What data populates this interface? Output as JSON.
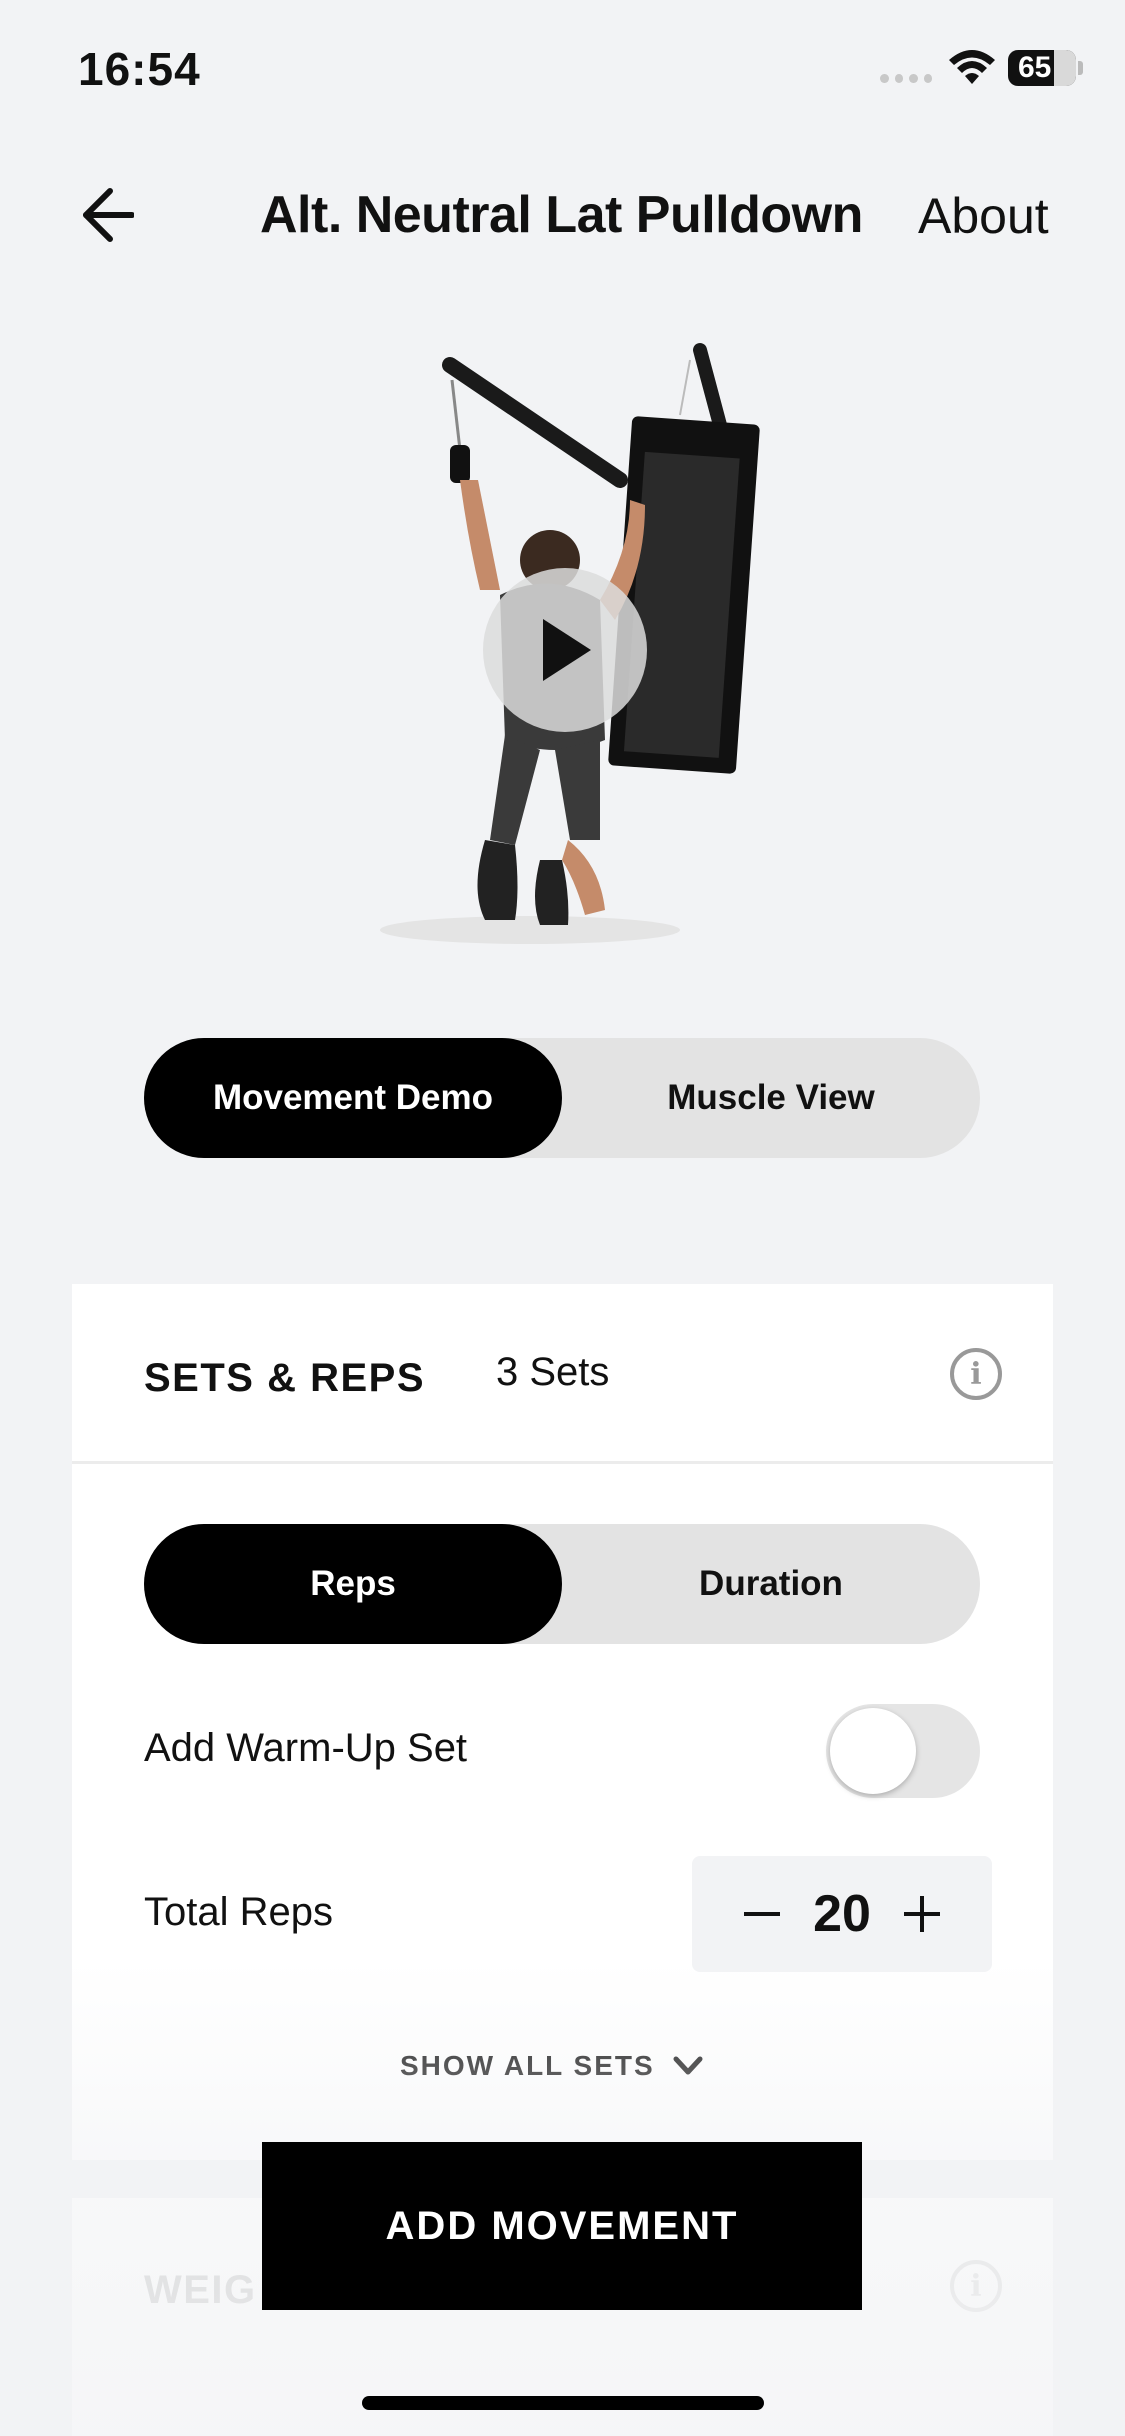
{
  "status_bar": {
    "time": "16:54",
    "battery": "65"
  },
  "header": {
    "title": "Alt. Neutral Lat Pulldown",
    "about_label": "About"
  },
  "icons": {
    "back": "arrow-left-icon",
    "play": "play-icon",
    "info": "info-icon",
    "chevron": "chevron-down-icon",
    "wifi": "wifi-icon"
  },
  "view_toggle": {
    "options": [
      "Movement Demo",
      "Muscle View"
    ],
    "selected": "Movement Demo"
  },
  "sets_reps_card": {
    "title": "SETS & REPS",
    "sets_summary": "3 Sets",
    "mode_toggle": {
      "options": [
        "Reps",
        "Duration"
      ],
      "selected": "Reps"
    },
    "warmup_label": "Add Warm-Up Set",
    "warmup_enabled": false,
    "total_reps_label": "Total Reps",
    "total_reps_value": "20",
    "show_all_label": "SHOW ALL SETS"
  },
  "weight_card": {
    "title": "WEIG"
  },
  "primary_action": {
    "label": "ADD MOVEMENT"
  }
}
